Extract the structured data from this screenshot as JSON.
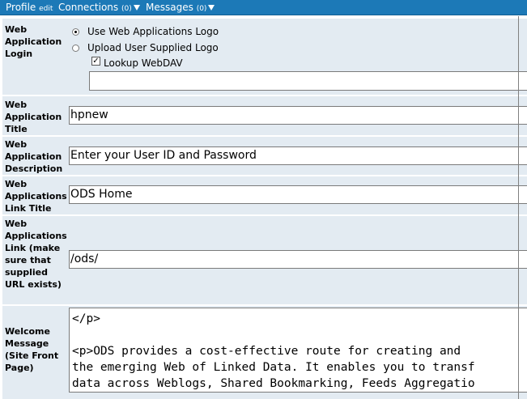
{
  "nav": {
    "profile": "Profile",
    "profile_edit": "edit",
    "connections": "Connections",
    "connections_count": "(0)",
    "messages": "Messages",
    "messages_count": "(0)"
  },
  "form": {
    "login": {
      "label": "Web Application Login",
      "option_default": "Use Web Applications Logo",
      "option_upload": "Upload User Supplied Logo",
      "lookup_label": "Lookup WebDAV",
      "logo_path": ""
    },
    "title": {
      "label": "Web Application Title",
      "value": "hpnew"
    },
    "description": {
      "label": "Web Application Description",
      "value": "Enter your User ID and Password"
    },
    "link_title": {
      "label": "Web Applications Link Title",
      "value": "ODS Home"
    },
    "link": {
      "label": "Web Applications Link (make sure that supplied URL exists)",
      "value": "/ods/"
    },
    "welcome": {
      "label": "Welcome Message (Site Front Page)",
      "value": "</p>\n\n<p>ODS provides a cost-effective route for creating and \nthe emerging Web of Linked Data. It enables you to transf\ndata across Weblogs, Shared Bookmarking, Feeds Aggregatio"
    }
  }
}
